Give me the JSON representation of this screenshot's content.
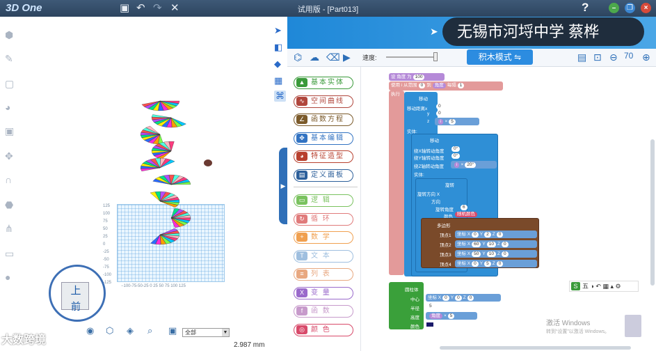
{
  "app": {
    "logo": "3D One",
    "title": "试用版 - [Part013]",
    "help": "?"
  },
  "titlebar_icons": [
    "save-icon",
    "undo-icon",
    "redo-icon",
    "close-cross-icon"
  ],
  "window_controls": {
    "minimize": "–",
    "restore": "❐",
    "close": "×"
  },
  "viewport": {
    "view_cube_top": "上",
    "view_cube_front": "前",
    "layer_select": "全部",
    "zoom_readout": "2.987 mm",
    "axis_labels_y": [
      "125",
      "100",
      "75",
      "50",
      "25",
      "0",
      "-25",
      "-50",
      "-75",
      "-100",
      "-125"
    ],
    "axis_labels_x": "−100-75-50-25  0  25  50  75 100 125",
    "watermark": "大数跨境"
  },
  "banner": "无锡市河埒中学  蔡桦",
  "toolbar": {
    "speed_label": "速度:",
    "mode_button": "积木模式  ⇋",
    "zoom_level": "70"
  },
  "categories": [
    {
      "label": "基本实体",
      "color": "#3a9a3a",
      "icon": "▲"
    },
    {
      "label": "空间曲线",
      "color": "#b0463c",
      "icon": "∿"
    },
    {
      "label": "函数方程",
      "color": "#7b5a2a",
      "icon": "∠"
    },
    {
      "label": "基本编辑",
      "color": "#3273c2",
      "icon": "✥"
    },
    {
      "label": "特征造型",
      "color": "#b8402e",
      "icon": "◕"
    },
    {
      "label": "定义面板",
      "color": "#2c5f9a",
      "icon": "▤"
    },
    {
      "label": "逻      辑",
      "color": "#7ac25f",
      "icon": "▭"
    },
    {
      "label": "循      环",
      "color": "#e07b7b",
      "icon": "↻"
    },
    {
      "label": "数      学",
      "color": "#f0a050",
      "icon": "+"
    },
    {
      "label": "文      本",
      "color": "#9fbfdf",
      "icon": "T"
    },
    {
      "label": "列      表",
      "color": "#e8a880",
      "icon": "≡"
    },
    {
      "label": "变      量",
      "color": "#9a6acb",
      "icon": "X"
    },
    {
      "label": "函      数",
      "color": "#c79acb",
      "icon": "f"
    },
    {
      "label": "颜      色",
      "color": "#d84a6a",
      "icon": "◎"
    }
  ],
  "code": {
    "set_var": "设 角度 为",
    "set_var_value": "100",
    "loop_label": "使用 i 从范围",
    "loop_from": "0",
    "loop_to_label": "到",
    "loop_to_var": "角度",
    "loop_step_label": "每隔",
    "loop_step": "1",
    "do_label": "执行",
    "move_label": "移动",
    "move_distance": "移动距离x",
    "x_val": "0",
    "y_label": "y",
    "y_val": "0",
    "z_label": "z",
    "z_mul": "×",
    "z_val": "5",
    "entity_label": "实体:",
    "rotate_label": "移动",
    "rot_x": "绕X轴转动角度",
    "rot_x_val": "0°",
    "rot_y": "绕Y轴转动角度",
    "rot_y_val": "0°",
    "rot_z": "绕Z轴转动角度",
    "rot_z_mul": "×",
    "rot_z_val": "20°",
    "spin_label": "旋转",
    "spin_axis": "旋转方向 X",
    "spin_dir": "方向",
    "spin_angle": "旋转角度",
    "spin_angle_val": "6",
    "color_label": "颜色",
    "color_random": "随机颜色",
    "polygon_label": "多边形",
    "vertex1": "顶点1",
    "vertex2": "顶点2",
    "vertex3": "顶点3",
    "vertex4": "顶点4",
    "v1": [
      "0",
      "2",
      "0"
    ],
    "v2": [
      "60",
      "10",
      "0"
    ],
    "v3": [
      "50",
      "10",
      "0"
    ],
    "v4": [
      "0",
      "5",
      "0"
    ],
    "cyl_label": "圆柱体",
    "cyl_center": "中心",
    "cyl_center_vals": [
      "0",
      "0",
      "0"
    ],
    "cyl_radius": "半径",
    "cyl_radius_val": "5",
    "cyl_height": "高度",
    "cyl_height_mul": "×",
    "cyl_height_val": "5",
    "cyl_color": "颜色"
  },
  "mini_toolbar": "五 ◑ ↶ ▦ ▴ ⚙",
  "mini_toolbar_badge": "S",
  "activation": {
    "title": "激活 Windows",
    "subtitle": "转到“设置”以激活 Windows。"
  }
}
